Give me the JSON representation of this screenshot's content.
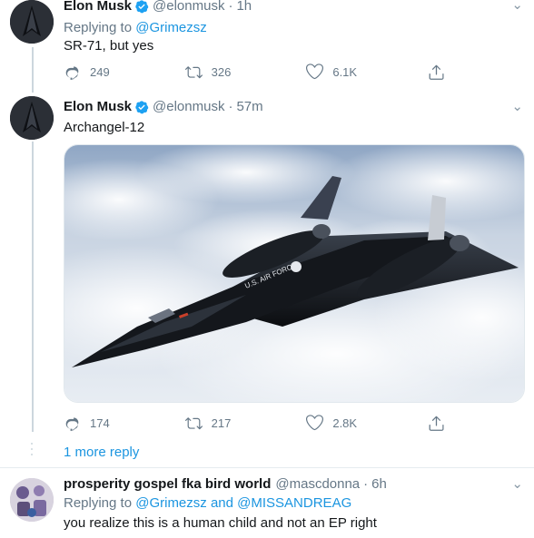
{
  "tweets": [
    {
      "display_name": "Elon Musk",
      "handle": "@elonmusk",
      "separator": "·",
      "time": "1h",
      "replying_prefix": "Replying to ",
      "replying_to": "@Grimezsz",
      "text": "SR-71, but yes",
      "replies": "249",
      "retweets": "326",
      "likes": "6.1K"
    },
    {
      "display_name": "Elon Musk",
      "handle": "@elonmusk",
      "separator": "·",
      "time": "57m",
      "text": "Archangel-12",
      "media_text": "U.S. AIR FORCE",
      "replies": "174",
      "retweets": "217",
      "likes": "2.8K"
    }
  ],
  "more_replies_label": "1 more reply",
  "reply_tweet": {
    "display_name": "prosperity gospel fka bird world",
    "handle": "@mascdonna",
    "separator": "·",
    "time": "6h",
    "replying_prefix": "Replying to ",
    "replying_to_1": "@Grimezsz",
    "and": " and ",
    "replying_to_2": "@MISSANDREAG",
    "text": "you realize this is a human child and not an EP right"
  },
  "colors": {
    "link": "#1b95e0",
    "secondary": "#657786",
    "verified": "#1da1f2"
  },
  "icons": [
    "chevron-down-icon",
    "verified-badge-icon",
    "reply-icon",
    "retweet-icon",
    "like-icon",
    "share-icon"
  ]
}
